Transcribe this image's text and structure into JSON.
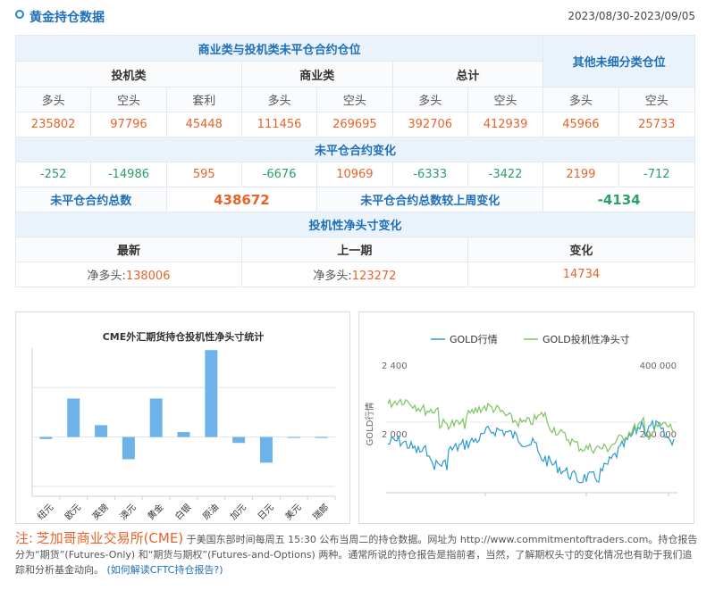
{
  "header": {
    "title": "黄金持仓数据",
    "date_range": "2023/08/30-2023/09/05"
  },
  "table": {
    "section_main": "商业类与投机类未平仓合约仓位",
    "section_other": "其他未细分类仓位",
    "groups": [
      "投机类",
      "商业类",
      "总计"
    ],
    "columns": [
      "多头",
      "空头",
      "套利",
      "多头",
      "空头",
      "多头",
      "空头",
      "多头",
      "空头"
    ],
    "positions": [
      "235802",
      "97796",
      "45448",
      "111456",
      "269695",
      "392706",
      "412939",
      "45966",
      "25733"
    ],
    "change_title": "未平仓合约变化",
    "changes": [
      "-252",
      "-14986",
      "595",
      "-6676",
      "10969",
      "-6333",
      "-3422",
      "2199",
      "-712"
    ],
    "oi_total_label": "未平仓合约总数",
    "oi_total": "438672",
    "oi_week_change_label": "未平仓合约总数较上周变化",
    "oi_week_change": "-4134",
    "net_title": "投机性净头寸变化",
    "net_cols": [
      "最新",
      "上一期",
      "变化"
    ],
    "net_prefix": "净多头:",
    "net_latest": "138006",
    "net_previous": "123272",
    "net_change": "14734"
  },
  "chart_data": [
    {
      "type": "bar",
      "title": "CME外汇期货持仓投机性净头寸统计",
      "categories": [
        "纽元",
        "欧元",
        "英镑",
        "澳元",
        "黄金",
        "白银",
        "原油",
        "加元",
        "日元",
        "美元",
        "瑞郎"
      ],
      "values": [
        -4000,
        78000,
        24000,
        -45000,
        78000,
        10000,
        176000,
        -12000,
        -52000,
        0,
        -2000
      ],
      "ylim": [
        -120000,
        180000
      ],
      "bar_color": "#6db3ea"
    },
    {
      "type": "line",
      "series": [
        {
          "name": "GOLD行情",
          "color": "#2b9bd1"
        },
        {
          "name": "GOLD投机性净头寸",
          "color": "#7cc45e"
        }
      ],
      "ylabel_left": "GOLD行情",
      "left_ticks": [
        "2 400",
        "2 000"
      ],
      "right_ticks": [
        "400 000",
        "200 000"
      ]
    }
  ],
  "note": {
    "prefix": "注:",
    "exchange": "芝加哥商业交易所(CME)",
    "body": "于美国东部时间每周五 15:30 公布当周二的持仓数据。网址为 http://www.commitmentoftraders.com。持仓报告分为“期货”(Futures-Only) 和“期货与期权”(Futures-and-Options) 两种。通常所说的持仓报告是指前者，当然，了解期权头寸的变化情况也有助于我们追踪和分析基金动向。",
    "link": "(如何解读CFTC持仓报告?)"
  }
}
